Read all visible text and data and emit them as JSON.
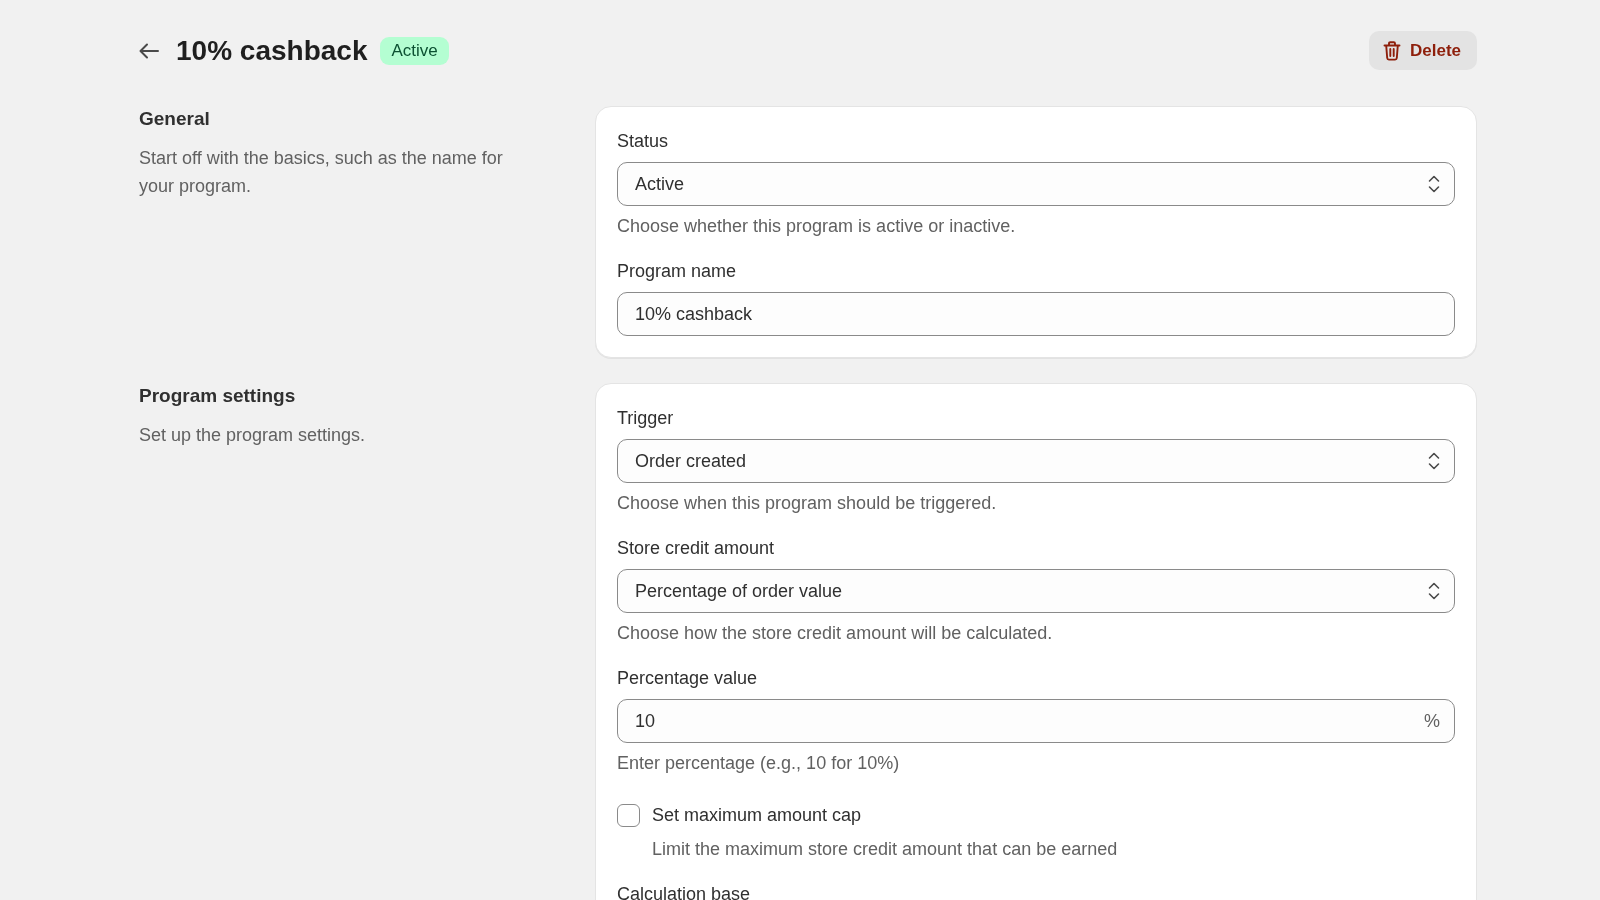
{
  "header": {
    "title": "10% cashback",
    "status_badge": "Active",
    "delete_button": "Delete"
  },
  "sections": [
    {
      "title": "General",
      "description": "Start off with the basics, such as the name for your program.",
      "fields": [
        {
          "kind": "select",
          "label": "Status",
          "value": "Active",
          "help": "Choose whether this program is active or inactive."
        },
        {
          "kind": "text",
          "label": "Program name",
          "value": "10% cashback"
        }
      ]
    },
    {
      "title": "Program settings",
      "description": "Set up the program settings.",
      "fields": [
        {
          "kind": "select",
          "label": "Trigger",
          "value": "Order created",
          "help": "Choose when this program should be triggered."
        },
        {
          "kind": "select",
          "label": "Store credit amount",
          "value": "Percentage of order value",
          "help": "Choose how the store credit amount will be calculated."
        },
        {
          "kind": "text",
          "label": "Percentage value",
          "value": "10",
          "suffix": "%",
          "help": "Enter percentage (e.g., 10 for 10%)"
        },
        {
          "kind": "checkbox",
          "label": "Set maximum amount cap",
          "checked": false,
          "help": "Limit the maximum store credit amount that can be earned"
        },
        {
          "kind": "label",
          "label": "Calculation base"
        }
      ]
    }
  ]
}
